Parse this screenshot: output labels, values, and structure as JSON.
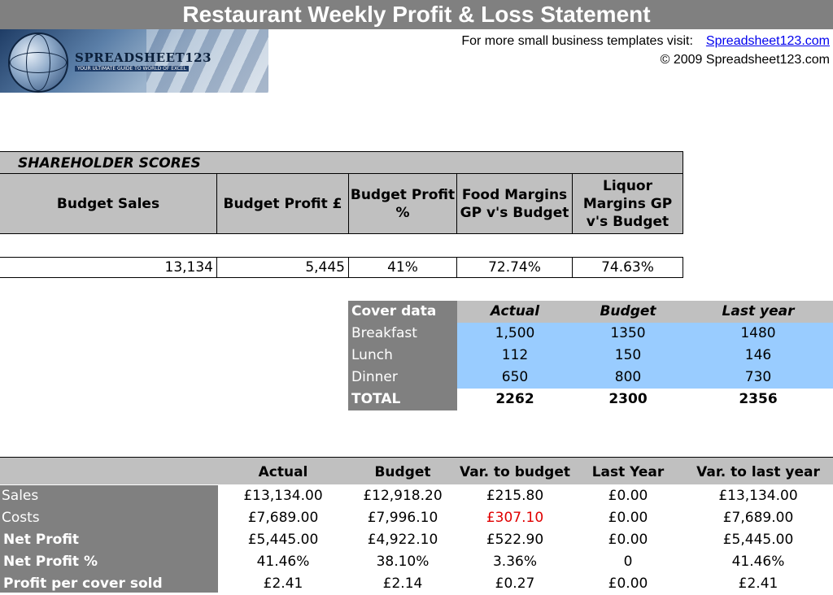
{
  "title": "Restaurant Weekly Profit & Loss Statement",
  "logo": {
    "name": "SPREADSHEET123",
    "tagline": "YOUR ULTIMATE GUIDE TO WORLD OF EXCEL"
  },
  "header": {
    "promo_text": "For more small business templates visit:",
    "promo_link": "Spreadsheet123.com",
    "copyright": "© 2009 Spreadsheet123.com"
  },
  "shareholder": {
    "title": "SHAREHOLDER SCORES",
    "headers": [
      "Budget Sales",
      "Budget Profit £",
      "Budget Profit %",
      "Food Margins GP v's Budget",
      "Liquor Margins GP v's Budget"
    ],
    "values": [
      "13,134",
      "5,445",
      "41%",
      "72.74%",
      "74.63%"
    ]
  },
  "cover": {
    "label": "Cover data",
    "columns": [
      "Actual",
      "Budget",
      "Last year"
    ],
    "rows": [
      {
        "label": "Breakfast",
        "values": [
          "1,500",
          "1350",
          "1480"
        ]
      },
      {
        "label": "Lunch",
        "values": [
          "112",
          "150",
          "146"
        ]
      },
      {
        "label": "Dinner",
        "values": [
          "650",
          "800",
          "730"
        ]
      }
    ],
    "total": {
      "label": "TOTAL",
      "values": [
        "2262",
        "2300",
        "2356"
      ]
    }
  },
  "pl": {
    "columns": [
      "Actual",
      "Budget",
      "Var. to budget",
      "Last Year",
      "Var. to last year"
    ],
    "rows": [
      {
        "label": "Sales",
        "values": [
          "£13,134.00",
          "£12,918.20",
          "£215.80",
          "£0.00",
          "£13,134.00"
        ]
      },
      {
        "label": "Costs",
        "values": [
          "£7,689.00",
          "£7,996.10",
          "£307.10",
          "£0.00",
          "£7,689.00"
        ]
      },
      {
        "label": "Net Profit",
        "values": [
          "£5,445.00",
          "£4,922.10",
          "£522.90",
          "£0.00",
          "£5,445.00"
        ]
      },
      {
        "label": "Net Profit %",
        "values": [
          "41.46%",
          "38.10%",
          "3.36%",
          "0",
          "41.46%"
        ]
      },
      {
        "label": "Profit per cover sold",
        "values": [
          "£2.41",
          "£2.14",
          "£0.27",
          "£0.00",
          "£2.41"
        ]
      }
    ]
  },
  "colors": {
    "negative": "#e00000",
    "highlight": "#99ccff",
    "label_bg": "#808080",
    "header_bg": "#c0c0c0"
  }
}
